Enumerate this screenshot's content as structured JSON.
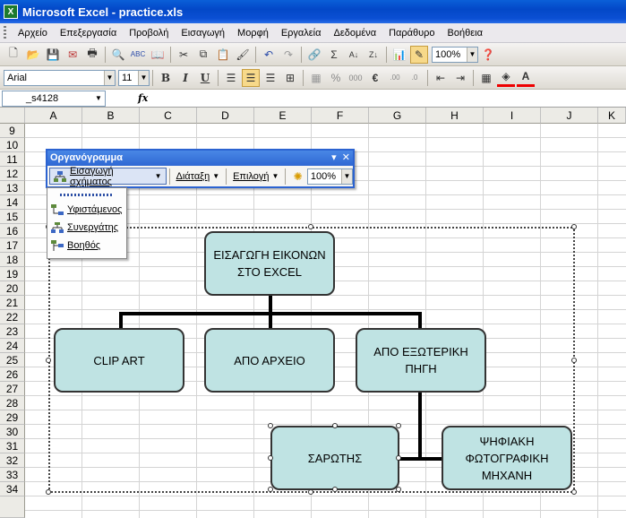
{
  "window": {
    "title": "Microsoft Excel - practice.xls"
  },
  "menubar": {
    "items": [
      "Αρχείο",
      "Επεξεργασία",
      "Προβολή",
      "Εισαγωγή",
      "Μορφή",
      "Εργαλεία",
      "Δεδομένα",
      "Παράθυρο",
      "Βοήθεια"
    ]
  },
  "standard_toolbar": {
    "zoom": "100%"
  },
  "format_toolbar": {
    "font": "Arial",
    "size": "11",
    "bold": "B",
    "italic": "I",
    "underline": "U",
    "percent": "%",
    "thousands": "000",
    "euro": "€"
  },
  "formula_bar": {
    "name_box": "_s4128",
    "fx": "fx"
  },
  "grid": {
    "columns": [
      "A",
      "B",
      "C",
      "D",
      "E",
      "F",
      "G",
      "H",
      "I",
      "J",
      "K"
    ],
    "rows": [
      "9",
      "10",
      "11",
      "12",
      "13",
      "14",
      "15",
      "16",
      "17",
      "18",
      "19",
      "20",
      "21",
      "22",
      "23",
      "24",
      "25",
      "26",
      "27",
      "28",
      "29",
      "30",
      "31",
      "32",
      "33",
      "34"
    ]
  },
  "org_toolbar": {
    "title": "Οργανόγραμμα",
    "insert_shape": "Εισαγωγή σχήματος",
    "layout": "Διάταξη",
    "select": "Επιλογή",
    "zoom": "100%"
  },
  "insert_menu": {
    "items": [
      "Υφιστάμενος",
      "Συνεργάτης",
      "Βοηθός"
    ]
  },
  "org_chart": {
    "root": "ΕΙΣΑΓΩΓΗ ΕΙΚΟΝΩΝ ΣΤΟ EXCEL",
    "children": [
      "CLIP ART",
      "ΑΠΟ ΑΡΧΕΙΟ",
      "ΑΠΟ ΕΞΩΤΕΡΙΚΗ ΠΗΓΗ"
    ],
    "grandchildren": [
      "ΣΑΡΩΤΗΣ",
      "ΨΗΦΙΑΚΗ ΦΩΤΟΓΡΑΦΙΚΗ ΜΗΧΑΝΗ"
    ]
  }
}
